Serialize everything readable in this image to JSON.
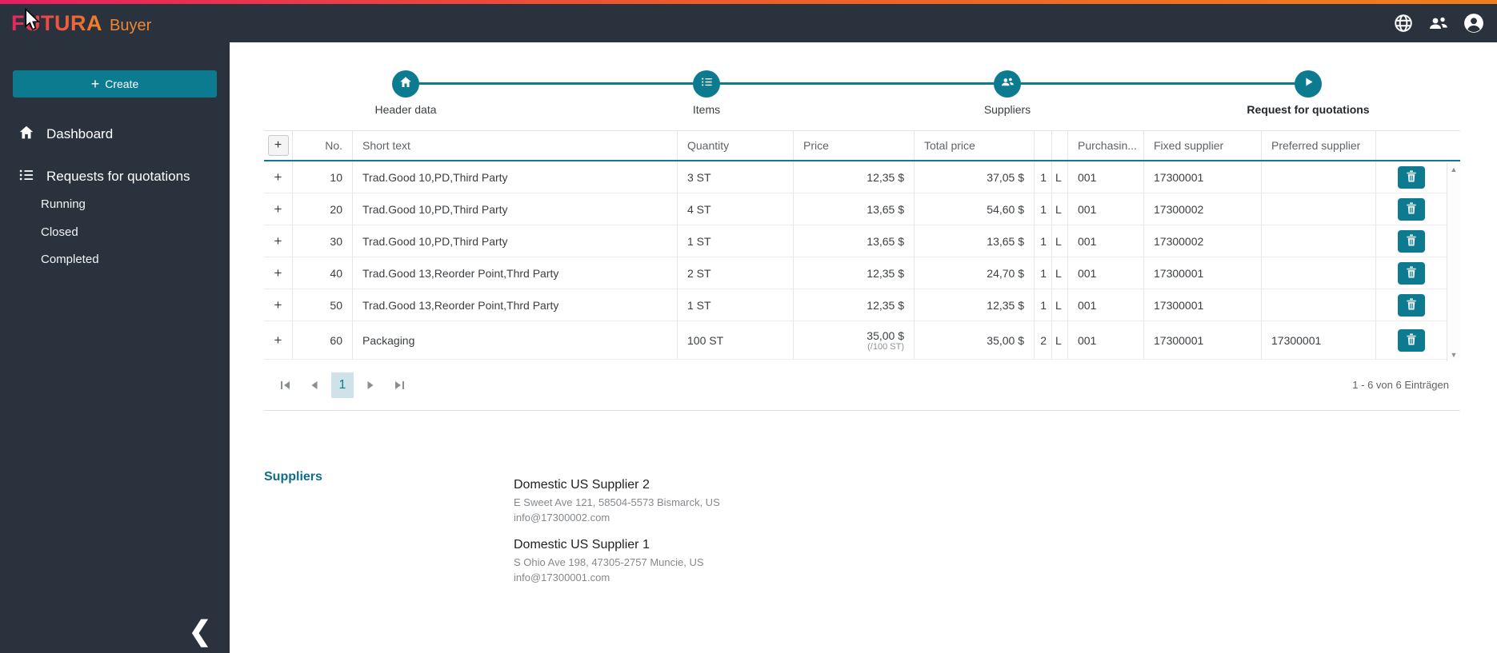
{
  "brand": {
    "logo": "FUTURA",
    "product": "Buyer"
  },
  "topbar": {
    "icons": [
      "globe-icon",
      "users-icon",
      "account-icon"
    ]
  },
  "colors": {
    "accent": "#0c7b90",
    "dark": "#2a333d",
    "stripe_from": "#e81e62",
    "stripe_to": "#f07f1a",
    "page_highlight": "#cfe2ea"
  },
  "sidebar": {
    "create_label": "Create",
    "create_plus": "+",
    "items": [
      {
        "label": "Dashboard"
      },
      {
        "label": "Requests for quotations"
      }
    ],
    "subitems": [
      {
        "label": "Running"
      },
      {
        "label": "Closed"
      },
      {
        "label": "Completed"
      }
    ],
    "collapse_glyph": "❮"
  },
  "stepper": {
    "steps": [
      {
        "label": "Header data",
        "icon": "home"
      },
      {
        "label": "Items",
        "icon": "list"
      },
      {
        "label": "Suppliers",
        "icon": "users"
      },
      {
        "label": "Request for quotations",
        "icon": "play"
      }
    ]
  },
  "table": {
    "expand_all": "+",
    "headers": {
      "no": "No.",
      "short_text": "Short text",
      "quantity": "Quantity",
      "price": "Price",
      "total_price": "Total price",
      "n1": "",
      "n2": "",
      "purchasing": "Purchasin...",
      "fixed_supplier": "Fixed supplier",
      "preferred_supplier": "Preferred supplier"
    },
    "rows": [
      {
        "expander": "+",
        "no": "10",
        "short_text": "Trad.Good 10,PD,Third Party",
        "quantity": "3 ST",
        "price": "12,35 $",
        "price_sub": "",
        "total": "37,05 $",
        "n1": "1",
        "n2": "L",
        "purchasing": "001",
        "fixed": "17300001",
        "preferred": ""
      },
      {
        "expander": "+",
        "no": "20",
        "short_text": "Trad.Good 10,PD,Third Party",
        "quantity": "4 ST",
        "price": "13,65 $",
        "price_sub": "",
        "total": "54,60 $",
        "n1": "1",
        "n2": "L",
        "purchasing": "001",
        "fixed": "17300002",
        "preferred": ""
      },
      {
        "expander": "+",
        "no": "30",
        "short_text": "Trad.Good 10,PD,Third Party",
        "quantity": "1 ST",
        "price": "13,65 $",
        "price_sub": "",
        "total": "13,65 $",
        "n1": "1",
        "n2": "L",
        "purchasing": "001",
        "fixed": "17300002",
        "preferred": ""
      },
      {
        "expander": "+",
        "no": "40",
        "short_text": "Trad.Good 13,Reorder Point,Thrd Party",
        "quantity": "2 ST",
        "price": "12,35 $",
        "price_sub": "",
        "total": "24,70 $",
        "n1": "1",
        "n2": "L",
        "purchasing": "001",
        "fixed": "17300001",
        "preferred": ""
      },
      {
        "expander": "+",
        "no": "50",
        "short_text": "Trad.Good 13,Reorder Point,Thrd Party",
        "quantity": "1 ST",
        "price": "12,35 $",
        "price_sub": "",
        "total": "12,35 $",
        "n1": "1",
        "n2": "L",
        "purchasing": "001",
        "fixed": "17300001",
        "preferred": ""
      },
      {
        "expander": "+",
        "no": "60",
        "short_text": "Packaging",
        "quantity": "100 ST",
        "price": "35,00 $",
        "price_sub": "(/100 ST)",
        "total": "35,00 $",
        "n1": "2",
        "n2": "L",
        "purchasing": "001",
        "fixed": "17300001",
        "preferred": "17300001"
      }
    ],
    "scroll_up": "▲",
    "scroll_down": "▼"
  },
  "pagination": {
    "page": "1",
    "summary": "1 - 6 von 6 Einträgen"
  },
  "suppliers_section": {
    "title": "Suppliers",
    "entries": [
      {
        "name": "Domestic US Supplier 2",
        "address": "E Sweet Ave 121, 58504-5573 Bismarck, US",
        "email": "info@17300002.com"
      },
      {
        "name": "Domestic US Supplier 1",
        "address": "S Ohio Ave 198, 47305-2757 Muncie, US",
        "email": "info@17300001.com"
      }
    ]
  }
}
